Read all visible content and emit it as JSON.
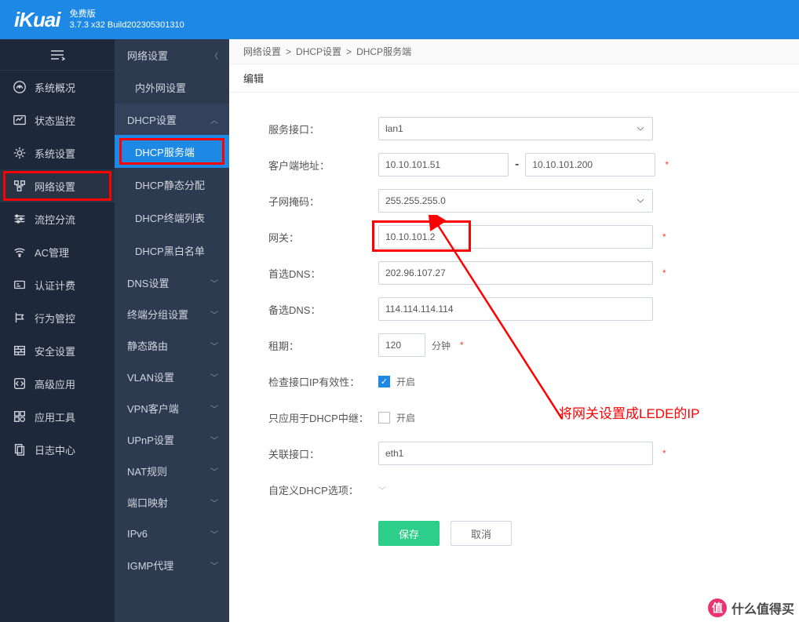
{
  "header": {
    "logo": "iKuai",
    "version_line1": "免费版",
    "version_line2": "3.7.3 x32 Build202305301310"
  },
  "nav_left": {
    "items": [
      {
        "icon": "dashboard",
        "label": "系统概况"
      },
      {
        "icon": "monitor",
        "label": "状态监控"
      },
      {
        "icon": "gear",
        "label": "系统设置"
      },
      {
        "icon": "network",
        "label": "网络设置",
        "active": true
      },
      {
        "icon": "flow",
        "label": "流控分流"
      },
      {
        "icon": "wifi",
        "label": "AC管理"
      },
      {
        "icon": "auth",
        "label": "认证计费"
      },
      {
        "icon": "behavior",
        "label": "行为管控"
      },
      {
        "icon": "security",
        "label": "安全设置"
      },
      {
        "icon": "advanced",
        "label": "高级应用"
      },
      {
        "icon": "tools",
        "label": "应用工具"
      },
      {
        "icon": "log",
        "label": "日志中心"
      }
    ]
  },
  "nav_right": {
    "head": "网络设置",
    "groups": [
      {
        "label": "内外网设置",
        "type": "item"
      },
      {
        "label": "DHCP设置",
        "type": "group",
        "expanded": true,
        "children": [
          {
            "label": "DHCP服务端",
            "active": true
          },
          {
            "label": "DHCP静态分配"
          },
          {
            "label": "DHCP终端列表"
          },
          {
            "label": "DHCP黑白名单"
          }
        ]
      },
      {
        "label": "DNS设置",
        "type": "group"
      },
      {
        "label": "终端分组设置",
        "type": "group"
      },
      {
        "label": "静态路由",
        "type": "group"
      },
      {
        "label": "VLAN设置",
        "type": "group"
      },
      {
        "label": "VPN客户端",
        "type": "group"
      },
      {
        "label": "UPnP设置",
        "type": "group"
      },
      {
        "label": "NAT规则",
        "type": "group"
      },
      {
        "label": "端口映射",
        "type": "group"
      },
      {
        "label": "IPv6",
        "type": "group"
      },
      {
        "label": "IGMP代理",
        "type": "group"
      }
    ]
  },
  "breadcrumb": [
    "网络设置",
    "DHCP设置",
    "DHCP服务端"
  ],
  "page_tab": "编辑",
  "form": {
    "service_if": {
      "label": "服务接口：",
      "value": "lan1"
    },
    "client_addr": {
      "label": "客户端地址：",
      "from": "10.10.101.51",
      "sep": "-",
      "to": "10.10.101.200"
    },
    "netmask": {
      "label": "子网掩码：",
      "value": "255.255.255.0"
    },
    "gateway": {
      "label": "网关：",
      "value": "10.10.101.2"
    },
    "dns1": {
      "label": "首选DNS：",
      "value": "202.96.107.27"
    },
    "dns2": {
      "label": "备选DNS：",
      "value": "114.114.114.114"
    },
    "lease": {
      "label": "租期：",
      "value": "120",
      "unit": "分钟"
    },
    "check_ip": {
      "label": "检查接口IP有效性：",
      "text": "开启",
      "checked": true
    },
    "relay_only": {
      "label": "只应用于DHCP中继：",
      "text": "开启",
      "checked": false
    },
    "assoc_if": {
      "label": "关联接口：",
      "value": "eth1"
    },
    "custom_dhcp": {
      "label": "自定义DHCP选项："
    }
  },
  "buttons": {
    "save": "保存",
    "cancel": "取消"
  },
  "annotation": "将网关设置成LEDE的IP",
  "watermark": "什么值得买"
}
